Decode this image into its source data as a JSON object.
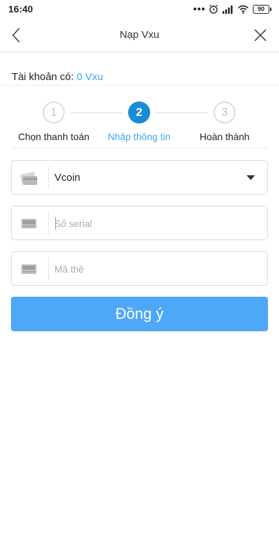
{
  "status_bar": {
    "time": "16:40",
    "battery": "90",
    "icons": [
      "more-dots-icon",
      "alarm-icon",
      "signal-icon",
      "wifi-icon",
      "battery-icon"
    ]
  },
  "header": {
    "title": "Nạp Vxu",
    "back_icon": "chevron-left-icon",
    "close_icon": "close-icon"
  },
  "account": {
    "label": "Tài khoản có:",
    "balance": "0 Vxu"
  },
  "stepper": {
    "current_step": 2,
    "steps": [
      {
        "number": "1",
        "label": "Chọn thanh toán",
        "state": "done"
      },
      {
        "number": "2",
        "label": "Nhập thông tin",
        "state": "active"
      },
      {
        "number": "3",
        "label": "Hoàn thành",
        "state": "pending"
      }
    ]
  },
  "form": {
    "card_type": {
      "icon": "card-icon",
      "value": "Vcoin"
    },
    "serial": {
      "icon": "number-card-icon",
      "placeholder": "Số serial",
      "value": ""
    },
    "card_code": {
      "icon": "number-card-icon",
      "placeholder": "Mã thẻ",
      "value": ""
    }
  },
  "submit": {
    "label": "Đồng ý"
  },
  "colors": {
    "accent": "#3ea7f1",
    "active_step": "#1b8bd8",
    "button": "#4ea8f7"
  }
}
